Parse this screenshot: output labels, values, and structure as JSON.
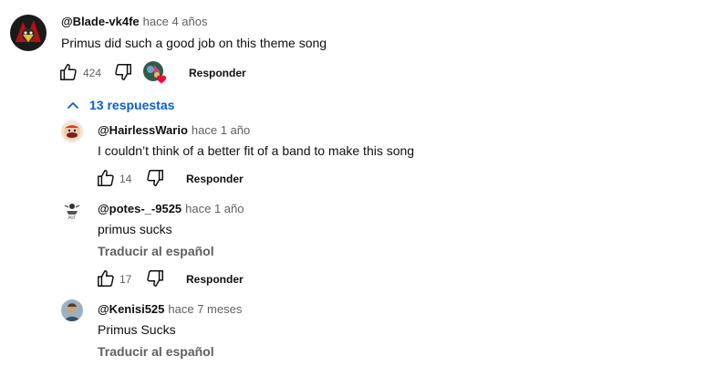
{
  "colors": {
    "link_blue": "#065fd4",
    "secondary_text": "#606060",
    "primary_text": "#0f0f0f",
    "heart_red": "#ff0033"
  },
  "main_comment": {
    "author": "@Blade-vk4fe",
    "time": "hace 4 años",
    "text": "Primus did such a good job on this theme song",
    "likes": "424",
    "reply_label": "Responder",
    "icons": [
      "like-icon",
      "dislike-icon",
      "creator-heart-icon"
    ]
  },
  "replies_toggle": {
    "label": "13 respuestas",
    "icon": "chevron-up-icon"
  },
  "replies": [
    {
      "author": "@HairlessWario",
      "time": "hace 1 año",
      "text": "I couldn’t think of a better fit of a band to make this song",
      "likes": "14",
      "reply_label": "Responder"
    },
    {
      "author": "@potes-_-9525",
      "time": "hace 1 año",
      "text": "primus sucks",
      "translate_label": "Traducir al español",
      "likes": "17",
      "reply_label": "Responder"
    },
    {
      "author": "@Kenisi525",
      "time": "hace 7 meses",
      "text": "Primus Sucks",
      "translate_label": "Traducir al español"
    }
  ]
}
